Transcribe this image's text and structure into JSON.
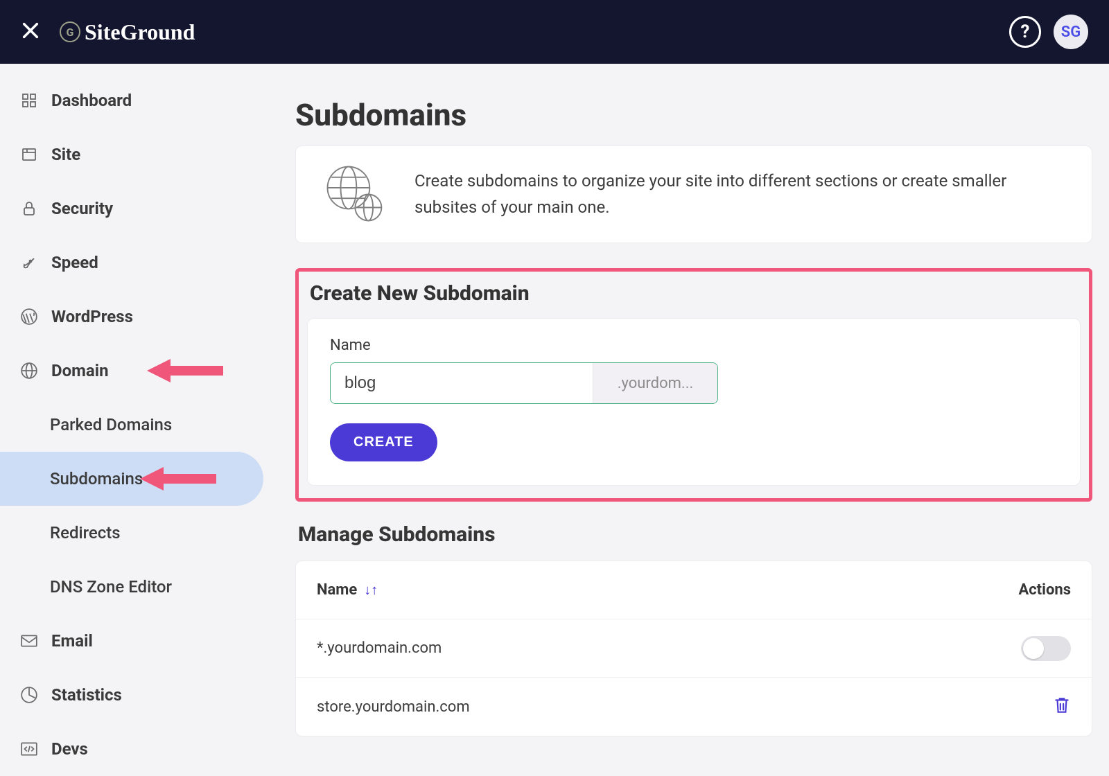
{
  "header": {
    "logo_text": "SiteGround",
    "avatar_initials": "SG",
    "help_label": "?"
  },
  "sidebar": {
    "items": [
      {
        "label": "Dashboard",
        "icon": "grid"
      },
      {
        "label": "Site",
        "icon": "page"
      },
      {
        "label": "Security",
        "icon": "lock"
      },
      {
        "label": "Speed",
        "icon": "rocket"
      },
      {
        "label": "WordPress",
        "icon": "wordpress"
      },
      {
        "label": "Domain",
        "icon": "globe"
      },
      {
        "label": "Email",
        "icon": "mail"
      },
      {
        "label": "Statistics",
        "icon": "pie"
      },
      {
        "label": "Devs",
        "icon": "code"
      }
    ],
    "domain_children": [
      {
        "label": "Parked Domains"
      },
      {
        "label": "Subdomains"
      },
      {
        "label": "Redirects"
      },
      {
        "label": "DNS Zone Editor"
      }
    ]
  },
  "page": {
    "title": "Subdomains",
    "info_text": "Create subdomains to organize your site into different sections or create smaller subsites of your main one."
  },
  "create": {
    "section_title": "Create New Subdomain",
    "name_label": "Name",
    "name_value": "blog",
    "domain_suffix": ".yourdom...",
    "button_label": "CREATE"
  },
  "manage": {
    "section_title": "Manage Subdomains",
    "col_name": "Name",
    "col_actions": "Actions",
    "rows": [
      {
        "name": "*.yourdomain.com",
        "action": "toggle"
      },
      {
        "name": "store.yourdomain.com",
        "action": "trash"
      }
    ]
  }
}
